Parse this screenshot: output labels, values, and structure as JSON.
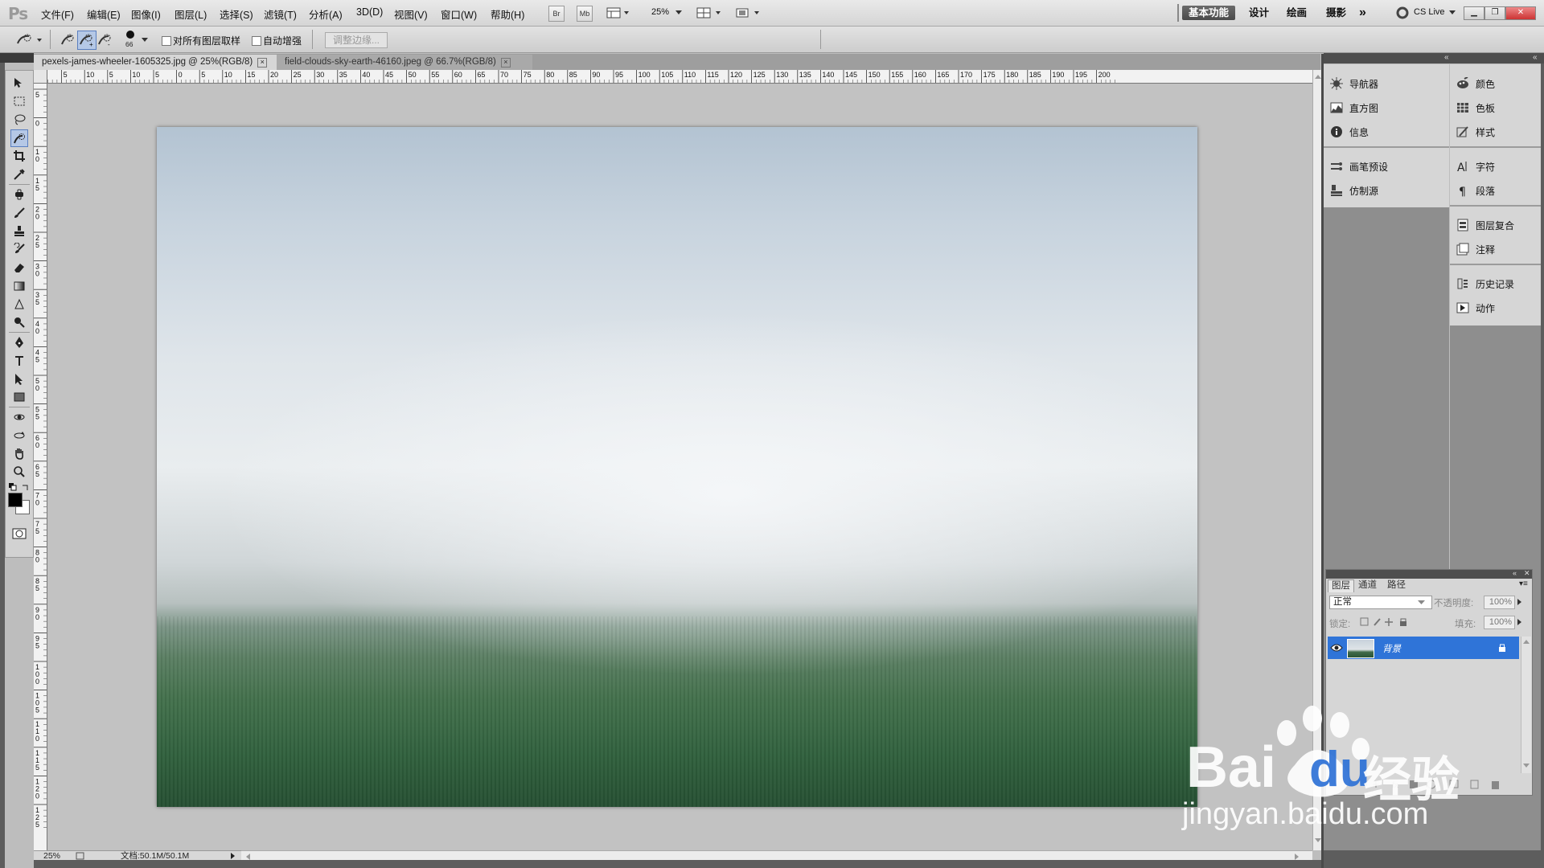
{
  "app": {
    "logo": "Ps"
  },
  "menu": [
    "文件(F)",
    "编辑(E)",
    "图像(I)",
    "图层(L)",
    "选择(S)",
    "滤镜(T)",
    "分析(A)",
    "3D(D)",
    "视图(V)",
    "窗口(W)",
    "帮助(H)"
  ],
  "appbar": {
    "bridge": "Br",
    "minibridge": "Mb",
    "zoom": "25%"
  },
  "workspaces": [
    "基本功能",
    "设计",
    "绘画",
    "摄影"
  ],
  "more_workspaces": "»",
  "cslive": "CS Live",
  "options": {
    "brush_size": "66",
    "sample_all_layers": "对所有图层取样",
    "auto_enhance": "自动增强",
    "refine_edge": "调整边缘..."
  },
  "doc_tabs": [
    {
      "label": "pexels-james-wheeler-1605325.jpg @ 25%(RGB/8)",
      "active": true
    },
    {
      "label": "field-clouds-sky-earth-46160.jpeg @ 66.7%(RGB/8)",
      "active": false
    }
  ],
  "ruler": {
    "h_labels": [
      "0",
      "5",
      "10",
      "5",
      "10",
      "5",
      "0",
      "5",
      "10",
      "15",
      "20",
      "25",
      "30",
      "35",
      "40",
      "45",
      "50",
      "55",
      "60",
      "65",
      "70",
      "75",
      "80",
      "85",
      "90",
      "95",
      "100",
      "105",
      "110",
      "115",
      "120",
      "125",
      "130",
      "135",
      "140",
      "145",
      "150",
      "155",
      "160",
      "165",
      "170",
      "175",
      "180",
      "185",
      "190",
      "195",
      "200"
    ],
    "v_labels": [
      "5",
      "0",
      "1 0",
      "1 5",
      "2 0",
      "2 5",
      "3 0",
      "3 5",
      "4 0",
      "4 5",
      "5 0",
      "5 5",
      "6 0",
      "6 5",
      "7 0",
      "7 5",
      "8 0",
      "8 5",
      "9 0",
      "9 5",
      "1 0 0",
      "1 0 5",
      "1 1 0",
      "1 1 5",
      "1 2 0",
      "1 2 5"
    ]
  },
  "status": {
    "zoom": "25%",
    "doc": "文档:50.1M/50.1M"
  },
  "panels_col1": [
    {
      "icon": "navigator-icon",
      "label": "导航器"
    },
    {
      "icon": "histogram-icon",
      "label": "直方图"
    },
    {
      "icon": "info-icon",
      "label": "信息"
    },
    {
      "icon": "brush-presets-icon",
      "label": "画笔预设"
    },
    {
      "icon": "clone-source-icon",
      "label": "仿制源"
    }
  ],
  "panels_col2": [
    {
      "icon": "color-icon",
      "label": "颜色"
    },
    {
      "icon": "swatches-icon",
      "label": "色板"
    },
    {
      "icon": "styles-icon",
      "label": "样式"
    },
    {
      "icon": "character-icon",
      "label": "字符"
    },
    {
      "icon": "paragraph-icon",
      "label": "段落"
    },
    {
      "icon": "layer-comps-icon",
      "label": "图层复合"
    },
    {
      "icon": "notes-icon",
      "label": "注释"
    },
    {
      "icon": "history-icon",
      "label": "历史记录"
    },
    {
      "icon": "actions-icon",
      "label": "动作"
    }
  ],
  "layers": {
    "tabs": [
      "图层",
      "通道",
      "路径"
    ],
    "blend_mode": "正常",
    "opacity_label": "不透明度:",
    "opacity": "100%",
    "lock_label": "锁定:",
    "fill_label": "填充:",
    "fill": "100%",
    "layer_name": "背景"
  },
  "watermark": {
    "brand": "Bai",
    "brand2": "du",
    "cn": "经验",
    "url": "jingyan.baidu.com"
  }
}
